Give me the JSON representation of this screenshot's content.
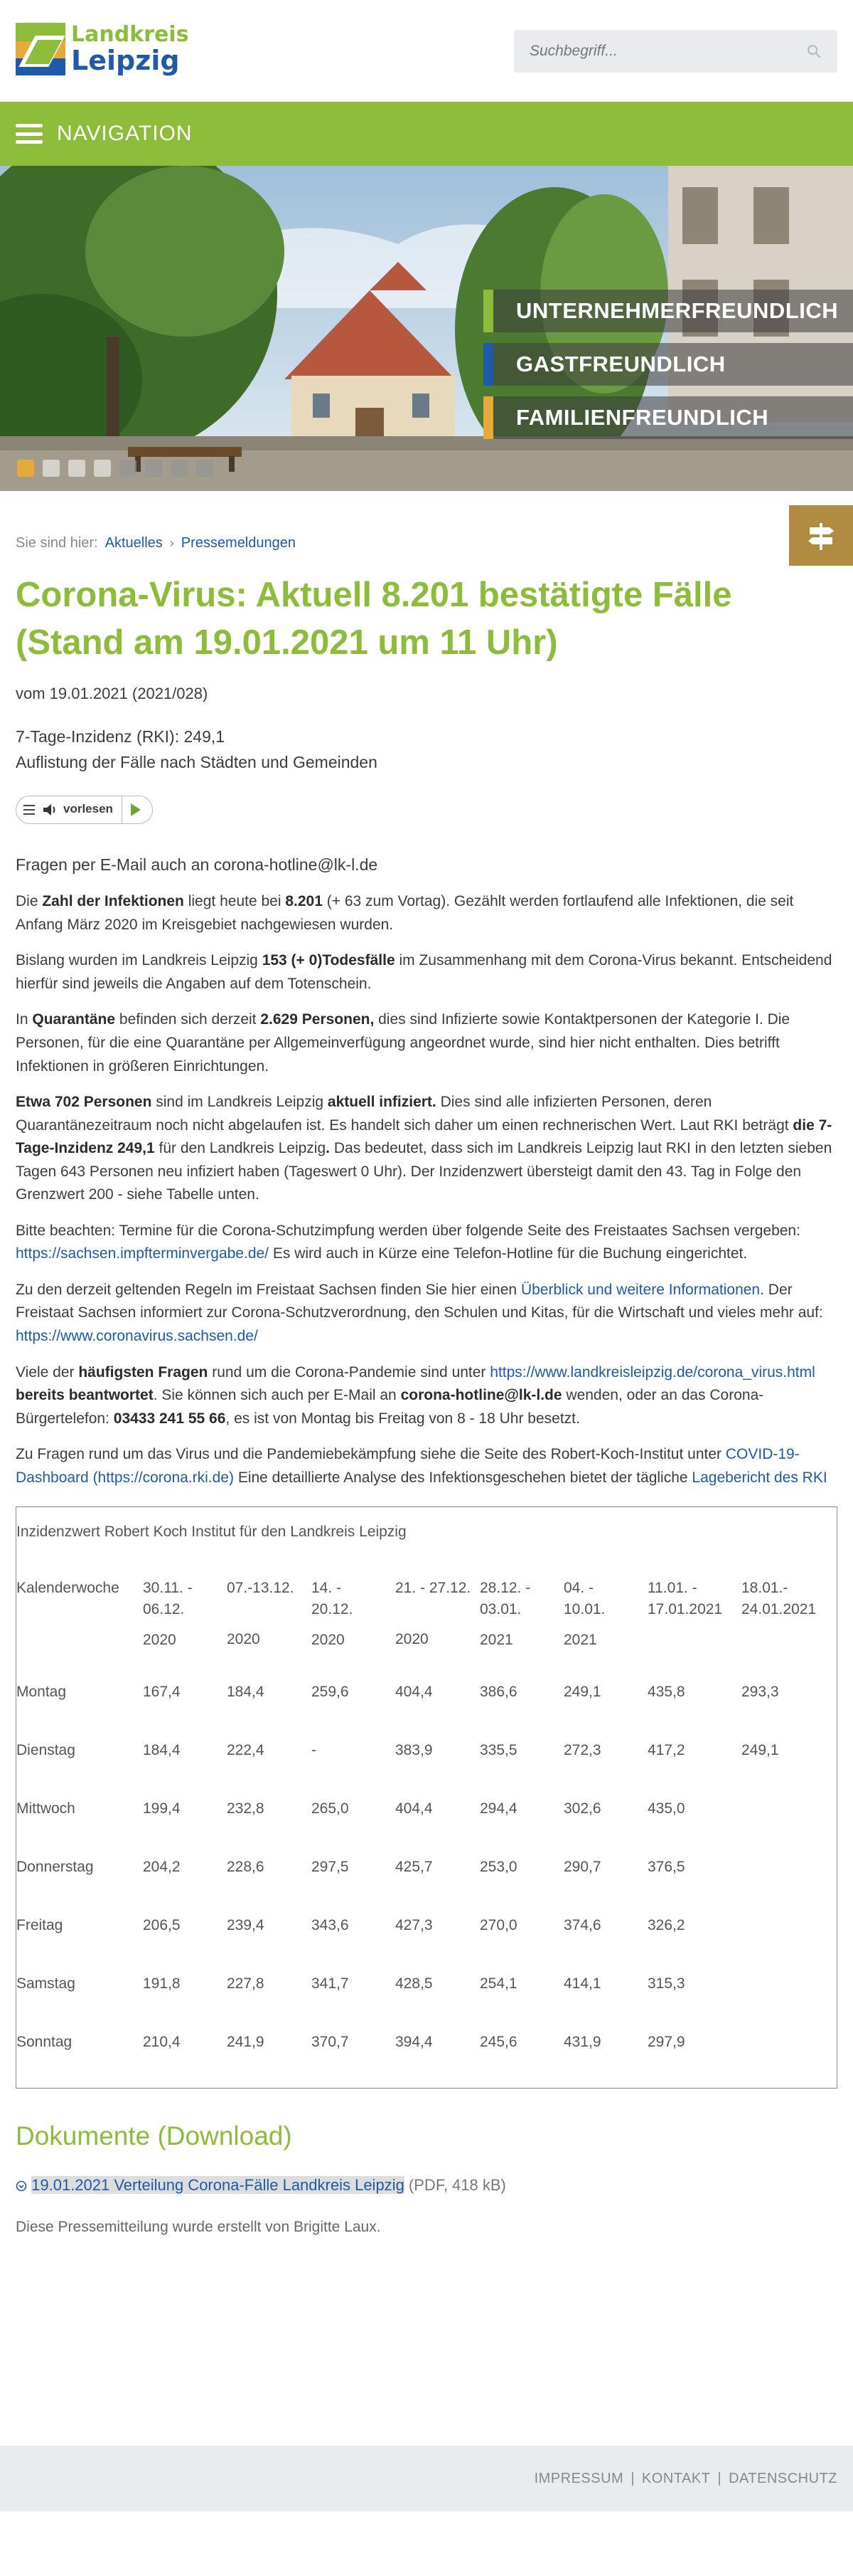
{
  "header": {
    "logo_line1": "Landkreis",
    "logo_line2": "Leipzig",
    "search_placeholder": "Suchbegriff..."
  },
  "nav": {
    "label": "NAVIGATION"
  },
  "hero": {
    "claims": [
      {
        "label": "UNTERNEHMERFREUNDLICH",
        "color": "#8dbb3a"
      },
      {
        "label": "GASTFREUNDLICH",
        "color": "#1f5aa6"
      },
      {
        "label": "FAMILIENFREUNDLICH",
        "color": "#e6a93a"
      }
    ],
    "slides_count": 8,
    "active_slide": 1
  },
  "breadcrumb": {
    "prefix": "Sie sind hier:",
    "items": [
      "Aktuelles",
      "Pressemeldungen"
    ]
  },
  "article": {
    "title": "Corona-Virus: Aktuell 8.201 bestätigte Fälle (Stand am 19.01.2021 um 11 Uhr)",
    "date": "vom 19.01.2021 (2021/028)",
    "incidence_line": "7-Tage-Inzidenz (RKI): 249,1",
    "list_line": "Auflistung der Fälle nach Städten und Gemeinden",
    "reader_label": "vorlesen",
    "lead": "Fragen per E-Mail auch an corona-hotline@lk-l.de",
    "p1": {
      "a": "Die ",
      "b1": "Zahl der Infektionen",
      "c": " liegt heute bei ",
      "b2": "8.201",
      "d": " (+ 63 zum Vortag). Gezählt werden fortlaufend alle Infektionen, die seit Anfang März 2020 im Kreisgebiet nachgewiesen wurden."
    },
    "p2": {
      "a": "Bislang wurden im Landkreis Leipzig ",
      "b1": "153 (+ 0)Todesfälle",
      "c": " im Zusammenhang mit dem Corona-Virus bekannt. Entscheidend hierfür sind jeweils die Angaben auf dem Totenschein."
    },
    "p3": {
      "a": "In ",
      "b1": "Quarantäne",
      "c": " befinden sich derzeit ",
      "b2": "2.629 Personen,",
      "d": " dies sind Infizierte sowie Kontaktpersonen der Kategorie I. Die Personen, für die eine Quarantäne per Allgemeinverfügung  angeordnet wurde, sind hier nicht enthalten. Dies betrifft Infektionen in größeren Einrichtungen."
    },
    "p4": {
      "b1": "Etwa 702 Personen",
      "a": " sind im Landkreis Leipzig ",
      "b2": "aktuell infiziert.",
      "c": " Dies sind alle infizierten Personen, deren Quarantänezeitraum noch nicht abgelaufen ist. Es handelt sich daher um einen rechnerischen Wert. Laut RKI beträgt ",
      "b3": "die 7-Tage-Inzidenz 249,1",
      "d": " für den Landkreis Leipzig",
      "b4": ".",
      "e": " Das bedeutet, dass sich im Landkreis Leipzig laut RKI in den letzten sieben Tagen 643 Personen neu infiziert haben (Tageswert 0 Uhr). Der Inzidenzwert übersteigt damit den 43. Tag in Folge den Grenzwert 200 - siehe Tabelle unten."
    },
    "p5": {
      "a": "Bitte beachten: Termine für die Corona-Schutzimpfung werden über folgende Seite des Freistaates Sachsen vergeben: ",
      "link": "https://sachsen.impfterminvergabe.de/",
      "b": "  Es wird auch in Kürze eine Telefon-Hotline für die Buchung eingerichtet."
    },
    "p6": {
      "a": "Zu den derzeit geltenden Regeln im Freistaat Sachsen finden Sie hier einen ",
      "link1": "Überblick und weitere Informationen",
      "b": ". Der Freistaat Sachsen informiert zur Corona-Schutzverordnung, den Schulen und Kitas, für die Wirtschaft und vieles mehr auf: ",
      "link2": "https://www.coronavirus.sachsen.de/"
    },
    "p7": {
      "a": "Viele der ",
      "b1": "häufigsten Fragen",
      "c": " rund um die Corona-Pandemie sind unter ",
      "link": "https://www.landkreisleipzig.de/corona_virus.html",
      "b2": " bereits beantwortet",
      "d": ". Sie können sich auch per E-Mail an ",
      "b3": "corona-hotline@lk-l.de",
      "e": " wenden, oder an das Corona-Bürgertelefon: ",
      "b4": "03433 241 55 66",
      "f": ", es ist von Montag bis Freitag von 8 - 18 Uhr besetzt."
    },
    "p8": {
      "a": "Zu Fragen rund um das Virus und die Pandemiebekämpfung siehe die Seite des Robert-Koch-Institut unter ",
      "link1": "COVID-19-Dashboard (https://corona.rki.de)",
      "b": "  Eine detaillierte Analyse des Infektionsgeschehen bietet der tägliche ",
      "link2": "Lagebericht des RKI"
    }
  },
  "table": {
    "title": "Inzidenzwert Robert Koch Institut für den Landkreis Leipzig",
    "corner": "Kalenderwoche",
    "columns": [
      {
        "line1": "30.11. -",
        "line2": "06.12.",
        "line3": "2020"
      },
      {
        "line1": "07.-13.12.",
        "line2": "",
        "line3": "2020"
      },
      {
        "line1": "14. -",
        "line2": "20.12.",
        "line3": "2020"
      },
      {
        "line1": "21. - 27.12.",
        "line2": "",
        "line3": "2020"
      },
      {
        "line1": "28.12. -",
        "line2": "03.01.",
        "line3": "2021"
      },
      {
        "line1": "04. -",
        "line2": "10.01.",
        "line3": "2021"
      },
      {
        "line1": "11.01. -",
        "line2": "17.01.2021",
        "line3": ""
      },
      {
        "line1": "18.01.-",
        "line2": "24.01.2021",
        "line3": ""
      }
    ],
    "rows": [
      {
        "day": "Montag",
        "values": [
          "167,4",
          "184,4",
          "259,6",
          "404,4",
          "386,6",
          "249,1",
          "435,8",
          "293,3"
        ]
      },
      {
        "day": "Dienstag",
        "values": [
          "184,4",
          "222,4",
          "-",
          "383,9",
          "335,5",
          "272,3",
          "417,2",
          "249,1"
        ]
      },
      {
        "day": "Mittwoch",
        "values": [
          "199,4",
          "232,8",
          "265,0",
          "404,4",
          "294,4",
          "302,6",
          "435,0",
          ""
        ]
      },
      {
        "day": "Donnerstag",
        "values": [
          "204,2",
          "228,6",
          "297,5",
          "425,7",
          "253,0",
          "290,7",
          "376,5",
          ""
        ]
      },
      {
        "day": "Freitag",
        "values": [
          "206,5",
          "239,4",
          "343,6",
          "427,3",
          "270,0",
          "374,6",
          "326,2",
          ""
        ]
      },
      {
        "day": "Samstag",
        "values": [
          "191,8",
          "227,8",
          "341,7",
          "428,5",
          "254,1",
          "414,1",
          "315,3",
          ""
        ]
      },
      {
        "day": "Sonntag",
        "values": [
          "210,4",
          "241,9",
          "370,7",
          "394,4",
          "245,6",
          "431,9",
          "297,9",
          ""
        ]
      }
    ]
  },
  "downloads": {
    "heading": "Dokumente (Download)",
    "link": "19.01.2021 Verteilung Corona-Fälle Landkreis Leipzig",
    "meta": " (PDF, 418 kB)"
  },
  "author": "Diese Pressemitteilung wurde erstellt von Brigitte Laux.",
  "footer": {
    "links": [
      "IMPRESSUM",
      "KONTAKT",
      "DATENSCHUTZ"
    ],
    "separator": "|"
  }
}
